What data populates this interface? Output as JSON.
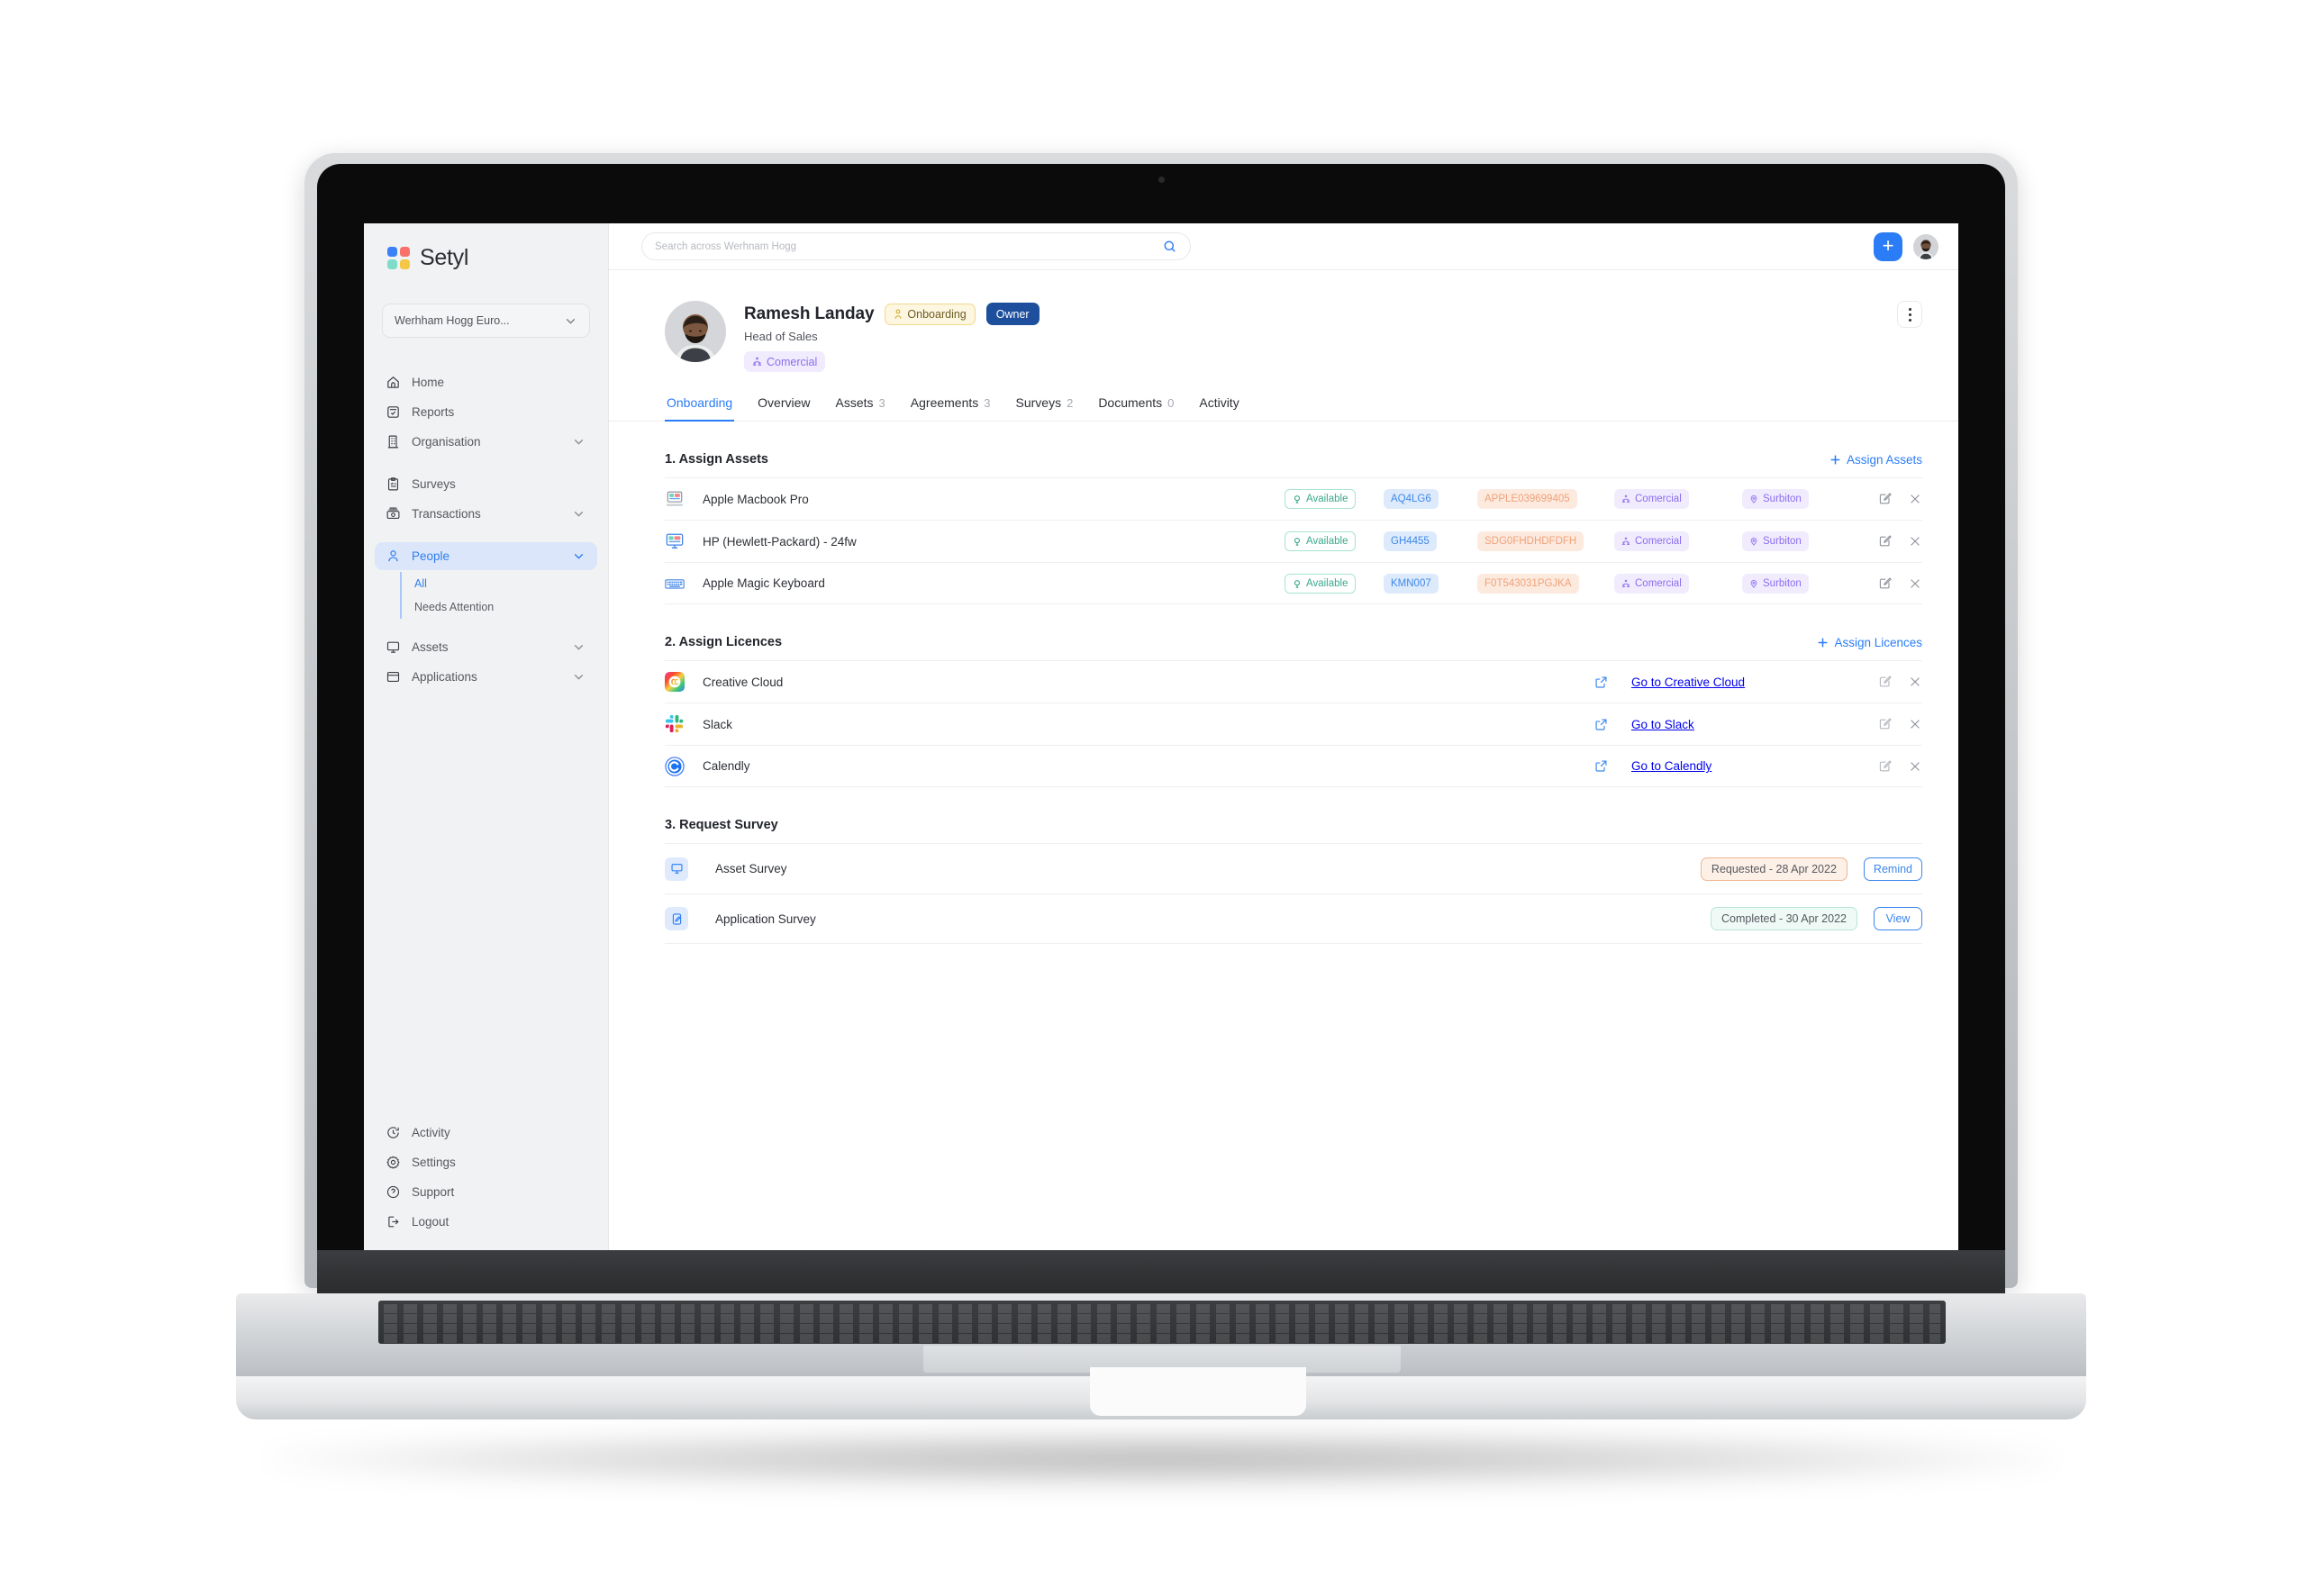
{
  "sidebar": {
    "brand": "Setyl",
    "org_selector": {
      "value": "Werhham Hogg Euro...",
      "icon": "chevron-down-icon"
    },
    "items": [
      {
        "label": "Home",
        "icon": "home-icon",
        "expandable": false
      },
      {
        "label": "Reports",
        "icon": "report-icon",
        "expandable": false
      },
      {
        "label": "Organisation",
        "icon": "building-icon",
        "expandable": true
      },
      {
        "label": "Surveys",
        "icon": "clipboard-icon",
        "expandable": false
      },
      {
        "label": "Transactions",
        "icon": "money-icon",
        "expandable": true
      },
      {
        "label": "People",
        "icon": "person-icon",
        "expandable": true,
        "active": true
      },
      {
        "label": "Assets",
        "icon": "monitor-icon",
        "expandable": true
      },
      {
        "label": "Applications",
        "icon": "window-icon",
        "expandable": true
      }
    ],
    "people_subitems": [
      {
        "label": "All",
        "active": true
      },
      {
        "label": "Needs Attention",
        "active": false
      }
    ],
    "bottom_items": [
      {
        "label": "Activity",
        "icon": "history-icon"
      },
      {
        "label": "Settings",
        "icon": "gear-icon"
      },
      {
        "label": "Support",
        "icon": "question-icon"
      },
      {
        "label": "Logout",
        "icon": "logout-icon"
      }
    ]
  },
  "topbar": {
    "search_placeholder": "Search across Werhnam Hogg",
    "search_value": "",
    "search_icon": "search-icon",
    "add_button_label": "+",
    "avatar": "user-avatar"
  },
  "profile": {
    "name": "Ramesh Landay",
    "role": "Head of Sales",
    "status_badge": "Onboarding",
    "owner_badge": "Owner",
    "team_badge": "Comercial",
    "menu_icon": "kebab-menu-icon"
  },
  "tabs": [
    {
      "label": "Onboarding",
      "count": "",
      "active": true
    },
    {
      "label": "Overview",
      "count": "",
      "active": false
    },
    {
      "label": "Assets",
      "count": "3",
      "active": false
    },
    {
      "label": "Agreements",
      "count": "3",
      "active": false
    },
    {
      "label": "Surveys",
      "count": "2",
      "active": false
    },
    {
      "label": "Documents",
      "count": "0",
      "active": false
    },
    {
      "label": "Activity",
      "count": "",
      "active": false
    }
  ],
  "assign_assets": {
    "title": "1. Assign Assets",
    "action": "Assign Assets",
    "action_icon": "plus-icon",
    "rows": [
      {
        "icon": "laptop-icon",
        "name": "Apple Macbook Pro",
        "status": "Available",
        "code": "AQ4LG6",
        "serial": "APPLE039699405",
        "team": "Comercial",
        "location": "Surbiton"
      },
      {
        "icon": "monitor-icon",
        "name": "HP (Hewlett-Packard) - 24fw",
        "status": "Available",
        "code": "GH4455",
        "serial": "SDG0FHDHDFDFH",
        "team": "Comercial",
        "location": "Surbiton"
      },
      {
        "icon": "keyboard-icon",
        "name": "Apple Magic Keyboard",
        "status": "Available",
        "code": "KMN007",
        "serial": "F0T543031PGJKA",
        "team": "Comercial",
        "location": "Surbiton"
      }
    ],
    "row_actions": {
      "edit": "edit-icon",
      "remove": "close-icon"
    }
  },
  "assign_licences": {
    "title": "2. Assign Licences",
    "action": "Assign Licences",
    "action_icon": "plus-icon",
    "rows": [
      {
        "icon": "adobe-creative-cloud-icon",
        "name": "Creative Cloud",
        "link": "Go to Creative Cloud",
        "link_icon": "external-link-icon"
      },
      {
        "icon": "slack-icon",
        "name": "Slack",
        "link": "Go to Slack",
        "link_icon": "external-link-icon"
      },
      {
        "icon": "calendly-icon",
        "name": "Calendly",
        "link": "Go to Calendly",
        "link_icon": "external-link-icon"
      }
    ],
    "row_actions": {
      "edit": "edit-icon",
      "remove": "close-icon"
    }
  },
  "request_survey": {
    "title": "3. Request Survey",
    "rows": [
      {
        "icon": "monitor-icon",
        "name": "Asset Survey",
        "status": "Requested - 28 Apr 2022",
        "status_type": "requested",
        "button": "Remind"
      },
      {
        "icon": "app-edit-icon",
        "name": "Application Survey",
        "status": "Completed - 30 Apr 2022",
        "status_type": "completed",
        "button": "View"
      }
    ]
  },
  "colors": {
    "accent_blue": "#2a7cf7",
    "owner_navy": "#1e4f9c",
    "badge_yellow": "#f2d98a",
    "team_purple": "#8b6df0",
    "available_green": "#3aa98b",
    "serial_orange": "#f0a179"
  }
}
